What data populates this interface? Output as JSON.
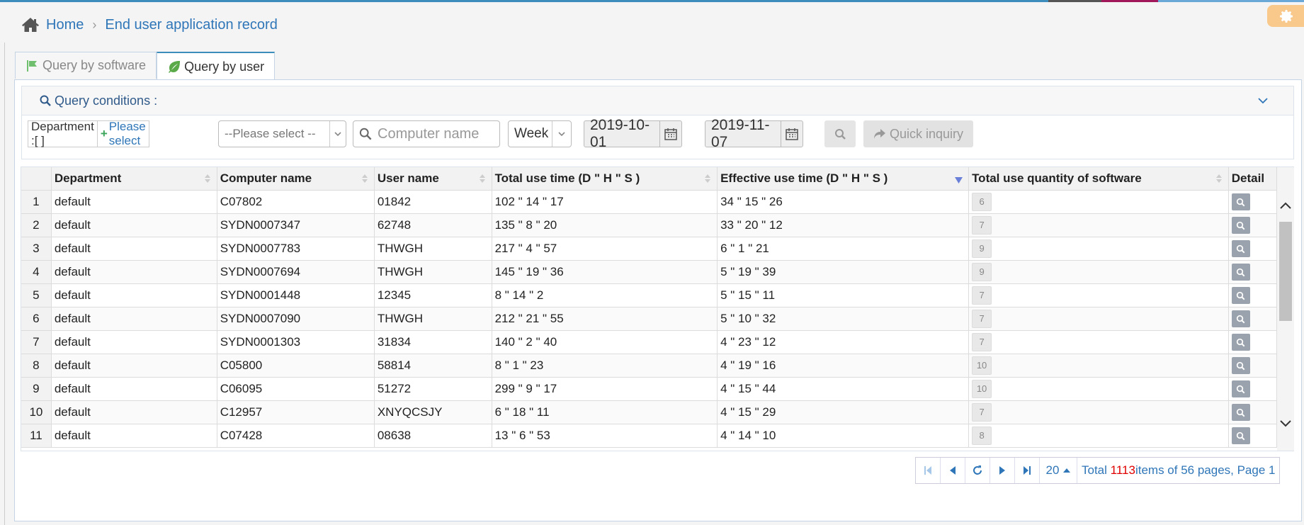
{
  "breadcrumb": {
    "home": "Home",
    "current": "End user application record"
  },
  "tabs": [
    {
      "label": "Query by software",
      "active": false
    },
    {
      "label": "Query by user",
      "active": true
    }
  ],
  "query": {
    "title": "Query conditions :",
    "department_label": "Department :[ ]",
    "department_select": "Please select",
    "select_value": "--Please select --",
    "computer_placeholder": "Computer name",
    "period": "Week",
    "date_from": "2019-10-01",
    "date_to": "2019-11-07",
    "quick_label": "Quick inquiry"
  },
  "table": {
    "columns": [
      "Department",
      "Computer name",
      "User name",
      "Total use time (D \" H \" S )",
      "Effective use time (D \" H \" S )",
      "Total use quantity of software",
      "Detail"
    ],
    "rows": [
      [
        "1",
        "default",
        "C07802",
        "01842",
        "102 \" 14 \" 17",
        "34 \" 15 \" 26",
        "6"
      ],
      [
        "2",
        "default",
        "SYDN0007347",
        "62748",
        "135 \" 8 \" 20",
        "33 \" 20 \" 12",
        "7"
      ],
      [
        "3",
        "default",
        "SYDN0007783",
        "THWGH",
        "217 \" 4 \" 57",
        "6 \" 1 \" 21",
        "9"
      ],
      [
        "4",
        "default",
        "SYDN0007694",
        "THWGH",
        "145 \" 19 \" 36",
        "5 \" 19 \" 39",
        "9"
      ],
      [
        "5",
        "default",
        "SYDN0001448",
        "12345",
        "8 \" 14 \" 2",
        "5 \" 15 \" 11",
        "7"
      ],
      [
        "6",
        "default",
        "SYDN0007090",
        "THWGH",
        "212 \" 21 \" 55",
        "5 \" 10 \" 32",
        "7"
      ],
      [
        "7",
        "default",
        "SYDN0001303",
        "31834",
        "140 \" 2 \" 40",
        "4 \" 23 \" 12",
        "7"
      ],
      [
        "8",
        "default",
        "C05800",
        "58814",
        "8 \" 1 \" 23",
        "4 \" 19 \" 16",
        "10"
      ],
      [
        "9",
        "default",
        "C06095",
        "51272",
        "299 \" 9 \" 17",
        "4 \" 15 \" 44",
        "10"
      ],
      [
        "10",
        "default",
        "C12957",
        "XNYQCSJY",
        "6 \" 18 \" 11",
        "4 \" 15 \" 29",
        "7"
      ],
      [
        "11",
        "default",
        "C07428",
        "08638",
        "13 \" 6 \" 53",
        "4 \" 14 \" 10",
        "8"
      ]
    ]
  },
  "pager": {
    "page_size": "20",
    "info_prefix": "Total ",
    "total": "1113",
    "info_suffix": " items of 56 pages, Page 1"
  },
  "colors": {
    "accent": "#3c8dbc",
    "link": "#2f76b8",
    "total_highlight": "#e00000",
    "gear_bg": "#f8c98a"
  }
}
